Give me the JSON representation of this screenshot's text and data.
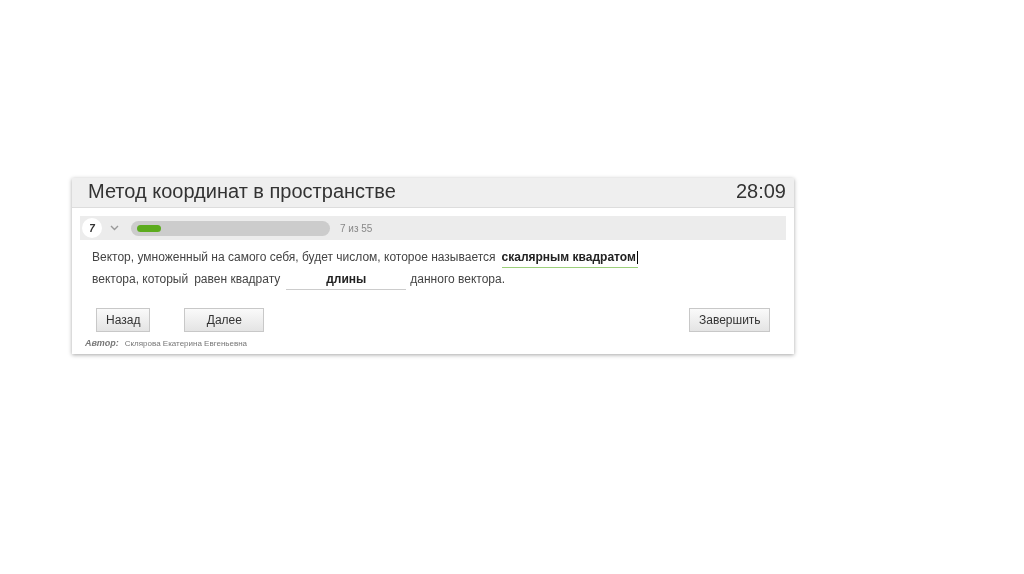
{
  "header": {
    "title": "Метод координат в пространстве",
    "timer": "28:09"
  },
  "progress": {
    "question_number": "7",
    "level": 0.13,
    "counter": "7 из 55"
  },
  "question": [
    {
      "kind": "text",
      "text": "Вектор, умноженный на самого себя, будет числом, которое называется"
    },
    {
      "kind": "blank",
      "value": "скалярным квадратом",
      "focused": true
    },
    {
      "kind": "text",
      "text": "вектора, который"
    },
    {
      "kind": "text",
      "text": "равен квадрату"
    },
    {
      "kind": "blank",
      "value": "длины",
      "focused": false
    },
    {
      "kind": "text",
      "text": "данного вектора."
    }
  ],
  "buttons": {
    "back": "Назад",
    "next": "Далее",
    "finish": "Завершить"
  },
  "author": {
    "label": "Автор:",
    "name": "Склярова Екатерина Евгеньевна"
  }
}
